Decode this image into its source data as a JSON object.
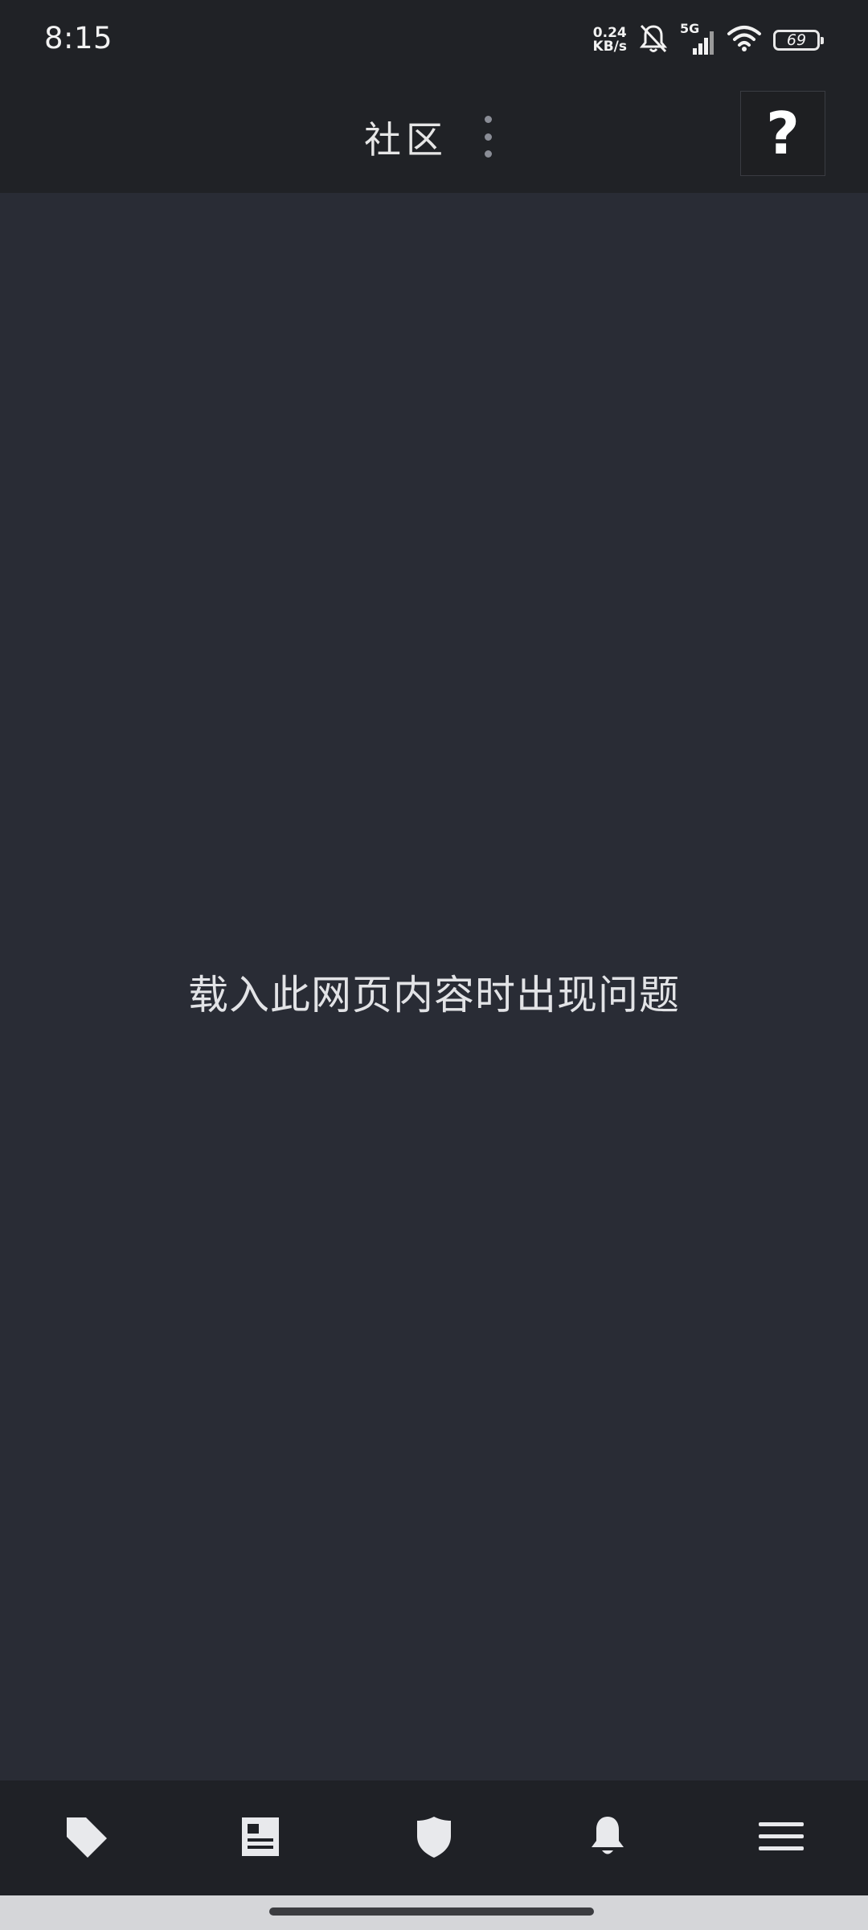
{
  "status_bar": {
    "time": "8:15",
    "net_speed_value": "0.24",
    "net_speed_unit": "KB/s",
    "network_type": "5G",
    "battery_level": "69",
    "icons": [
      "mute-bell-icon",
      "cellular-signal-icon",
      "wifi-icon",
      "battery-icon"
    ]
  },
  "header": {
    "title": "社区",
    "menu_icon": "more-vertical-icon",
    "help_label": "?"
  },
  "main": {
    "error_message": "载入此网页内容时出现问题"
  },
  "bottom_nav": {
    "items": [
      {
        "icon": "tag-icon"
      },
      {
        "icon": "news-icon"
      },
      {
        "icon": "shield-icon"
      },
      {
        "icon": "bell-icon"
      },
      {
        "icon": "hamburger-menu-icon"
      }
    ]
  },
  "colors": {
    "header_bg": "#202226",
    "content_bg": "#292c35",
    "nav_bg": "#1f2126",
    "text": "#e2e3e6",
    "icon": "#e8e9ec"
  }
}
